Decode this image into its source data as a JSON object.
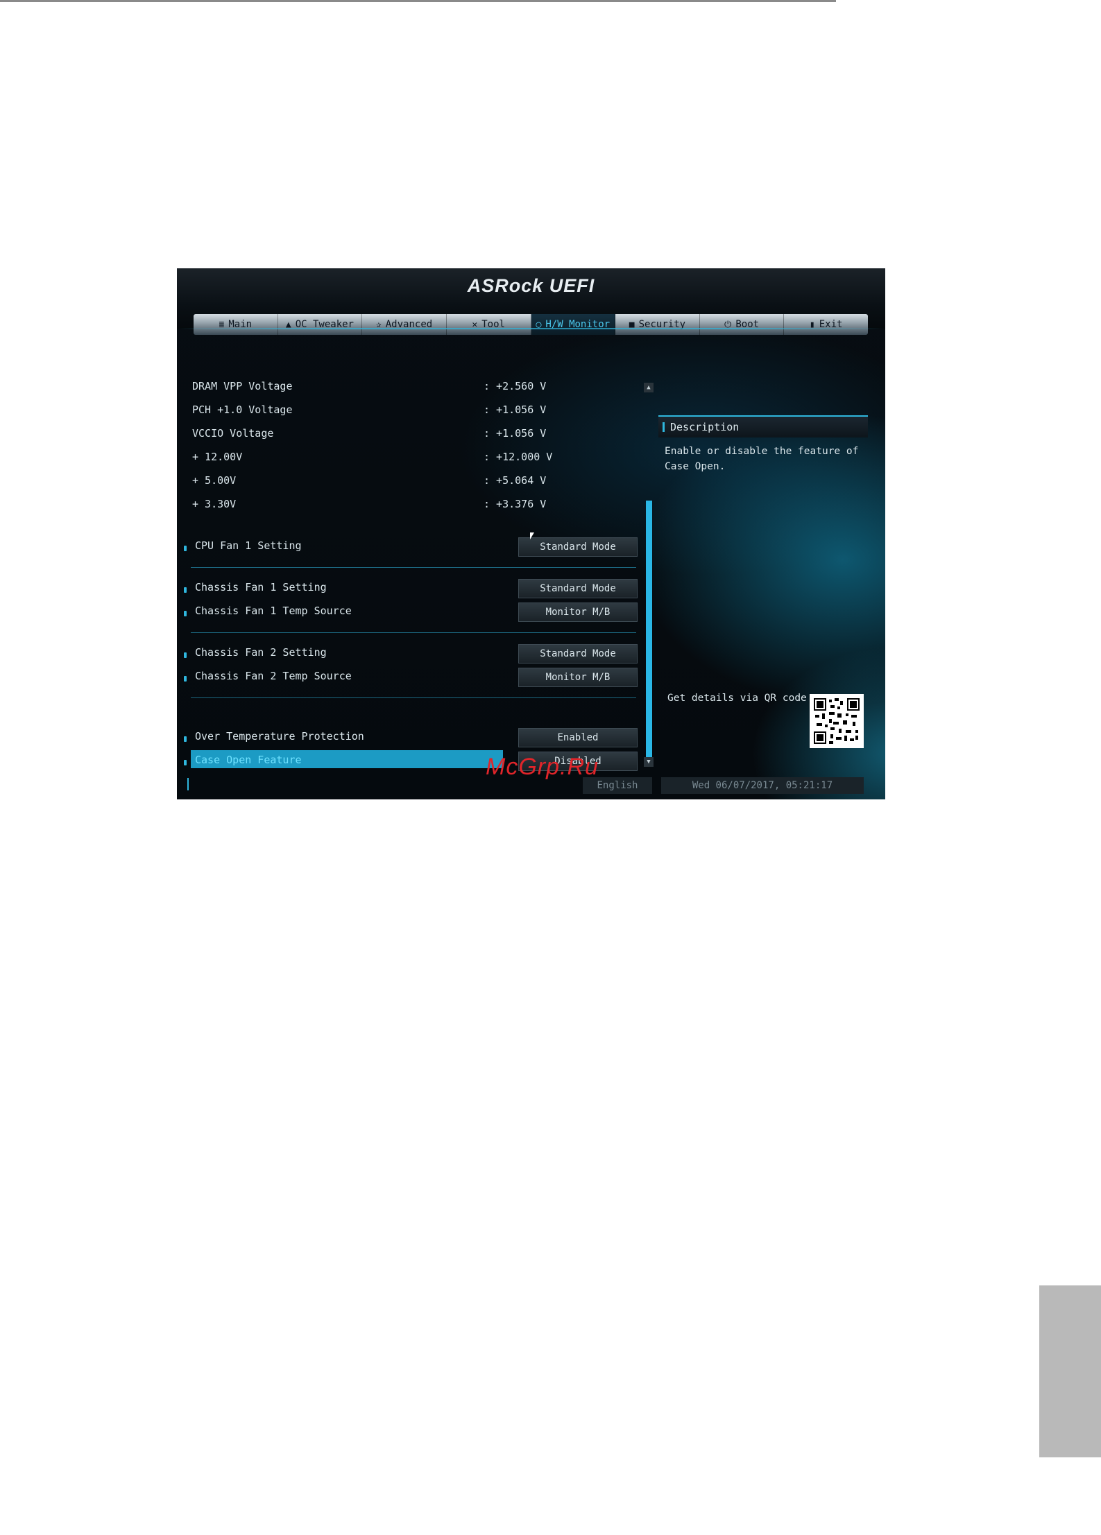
{
  "brand": "ASRock UEFI",
  "tabs": [
    {
      "label": "Main",
      "icon": "menu-icon",
      "glyph": "≣"
    },
    {
      "label": "OC Tweaker",
      "icon": "flame-icon",
      "glyph": "▲"
    },
    {
      "label": "Advanced",
      "icon": "star-icon",
      "glyph": "✰"
    },
    {
      "label": "Tool",
      "icon": "tool-icon",
      "glyph": "✕"
    },
    {
      "label": "H/W Monitor",
      "icon": "monitor-circle-icon",
      "glyph": "◯"
    },
    {
      "label": "Security",
      "icon": "shield-icon",
      "glyph": "■"
    },
    {
      "label": "Boot",
      "icon": "power-icon",
      "glyph": "⏻"
    },
    {
      "label": "Exit",
      "icon": "exit-icon",
      "glyph": "▮"
    }
  ],
  "active_tab": "H/W Monitor",
  "voltages": [
    {
      "label": "DRAM VPP Voltage",
      "value": ": +2.560 V"
    },
    {
      "label": "PCH +1.0 Voltage",
      "value": ": +1.056 V"
    },
    {
      "label": "VCCIO Voltage",
      "value": ": +1.056 V"
    },
    {
      "label": "+ 12.00V",
      "value": ": +12.000 V"
    },
    {
      "label": "+ 5.00V",
      "value": ": +5.064 V"
    },
    {
      "label": "+ 3.30V",
      "value": ": +3.376 V"
    }
  ],
  "settings": [
    {
      "label": "CPU Fan 1 Setting",
      "value": "Standard Mode"
    },
    {
      "label": "Chassis Fan 1 Setting",
      "value": "Standard Mode"
    },
    {
      "label": "Chassis Fan 1 Temp Source",
      "value": "Monitor M/B"
    },
    {
      "label": "Chassis Fan 2 Setting",
      "value": "Standard Mode"
    },
    {
      "label": "Chassis Fan 2 Temp Source",
      "value": "Monitor M/B"
    },
    {
      "label": "Over Temperature Protection",
      "value": "Enabled"
    },
    {
      "label": "Case Open Feature",
      "value": "Disabled"
    }
  ],
  "description": {
    "title": "Description",
    "text": "Enable or disable the feature of Case Open."
  },
  "qr_label": "Get details via QR code",
  "footer": {
    "language": "English",
    "datetime": "Wed 06/07/2017, 05:21:17"
  },
  "watermark": "McGrp.Ru",
  "colors": {
    "accent": "#2fb7de",
    "highlight": "#1c9bc4",
    "watermark": "#e0252a"
  }
}
